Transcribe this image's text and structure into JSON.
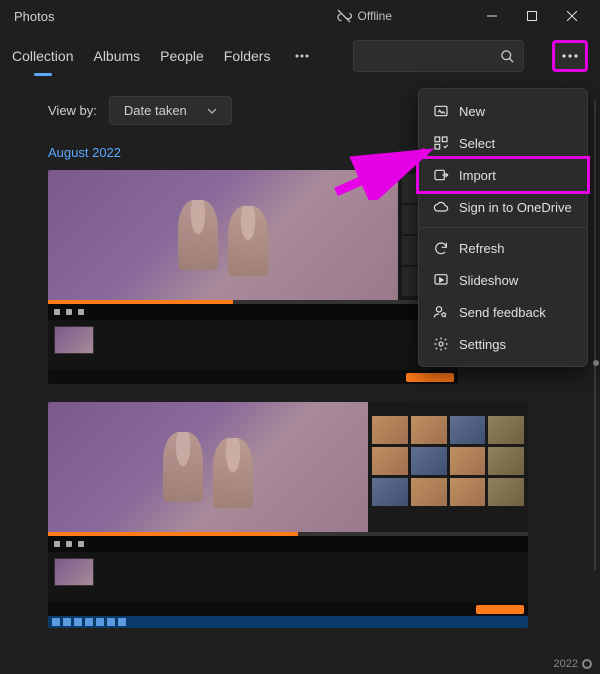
{
  "app_title": "Photos",
  "offline_label": "Offline",
  "tabs": [
    "Collection",
    "Albums",
    "People",
    "Folders"
  ],
  "viewby": {
    "label": "View by:",
    "value": "Date taken"
  },
  "date_header": "August 2022",
  "menu": {
    "new": "New",
    "select": "Select",
    "import": "Import",
    "signin": "Sign in to OneDrive",
    "refresh": "Refresh",
    "slideshow": "Slideshow",
    "feedback": "Send feedback",
    "settings": "Settings"
  },
  "scroll_year": "2022"
}
